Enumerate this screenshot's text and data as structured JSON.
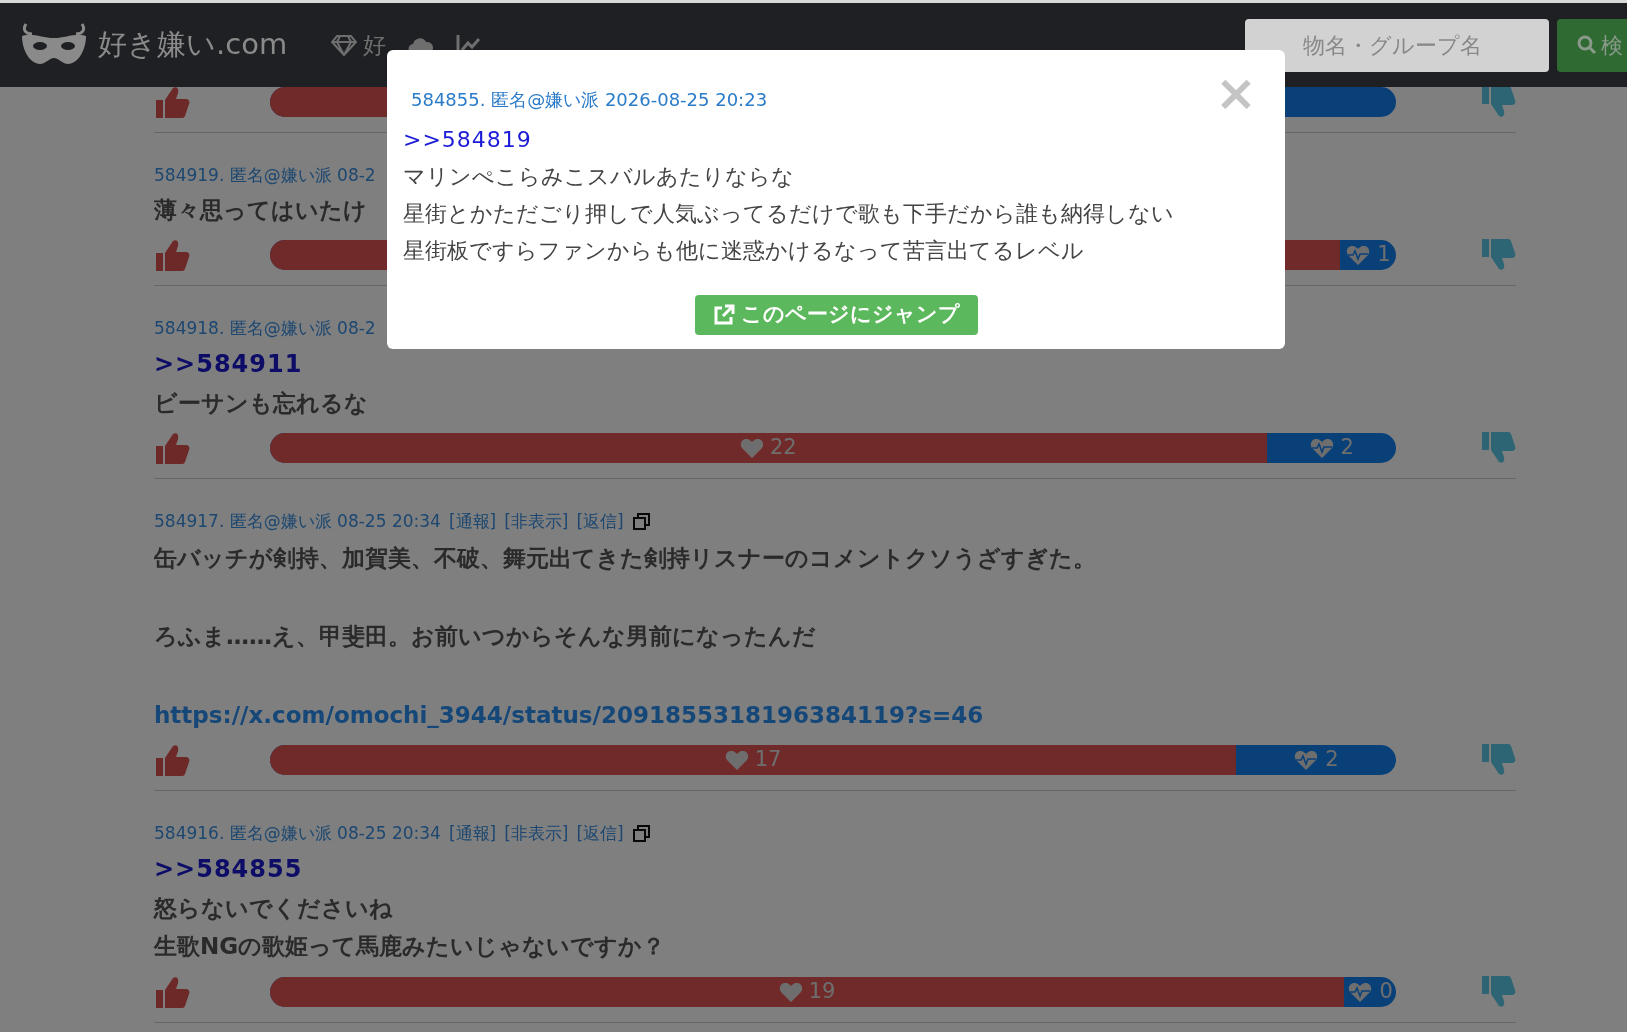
{
  "navbar": {
    "logo": "好き嫌い.com",
    "links": [
      {
        "kind": "diamond",
        "label": "好"
      },
      {
        "kind": "cloud"
      },
      {
        "kind": "chart"
      }
    ],
    "search": {
      "placeholder": "物名・グループ名"
    },
    "search_button": "検"
  },
  "comments": [
    {
      "level": 0.9
    },
    {
      "meta": "584919. 匿名@嫌い派 08-2",
      "lines": [
        "薄々思ってはいたけ"
      ],
      "dislikes": "1",
      "level": 0.95
    },
    {
      "meta": "584918. 匿名@嫌い派 08-2",
      "reply_to": ">>584911",
      "lines": [
        "ビーサンも忘れるな"
      ],
      "likes": "22",
      "dislikes": "2",
      "level": 0.885
    },
    {
      "meta": "584917. 匿名@嫌い派 08-25 20:34",
      "actions": [
        "[通報]",
        "[非表示]",
        "[返信]"
      ],
      "paragraphs": [
        "缶バッチが剣持、加賀美、不破、舞元出てきた剣持リスナーのコメントクソうざすぎた。",
        "ろふま……え、甲斐田。お前いつからそんな男前になったんだ"
      ],
      "link": "https://x.com/omochi_3944/status/2091855318196384119?s=46",
      "likes": "17",
      "dislikes": "2",
      "level": 0.858
    },
    {
      "meta": "584916. 匿名@嫌い派 08-25 20:34",
      "actions": [
        "[通報]",
        "[非表示]",
        "[返信]"
      ],
      "reply_to": ">>584855",
      "lines": [
        "怒らないでくださいね",
        "生歌NGの歌姫って馬鹿みたいじゃないですか？"
      ],
      "likes": "19",
      "dislikes": "0",
      "level": 0.954
    }
  ],
  "modal": {
    "close": "×",
    "meta": "584855. 匿名@嫌い派 2026-08-25 20:23",
    "reply_to": ">>584819",
    "lines": [
      "マリンぺこらみこスバルあたりならな",
      "星街とかただごり押しで人気ぶってるだけで歌も下手だから誰も納得しない",
      "星街板ですらファンからも他に迷惑かけるなって苦言出てるレベル"
    ],
    "button": "このページにジャンプ"
  }
}
